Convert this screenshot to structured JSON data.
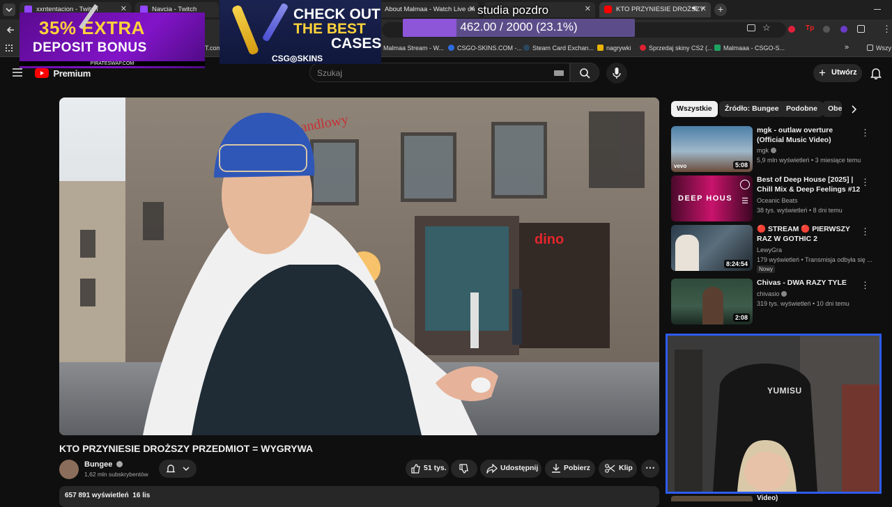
{
  "browser": {
    "tabs": [
      {
        "label": "xxntentacion - Twitch",
        "color": "#9146ff"
      },
      {
        "label": "Navcia - Twitch",
        "color": "#9146ff"
      },
      {
        "label": "About Malmaa - Watch Live on",
        "color": "#9146ff"
      },
      {
        "label": "studia pozdro - Watc",
        "color": "#9146ff"
      },
      {
        "label": "KTO PRZYNIESIE DROŻSZY",
        "color": "#ff0000"
      }
    ],
    "bookmarks": [
      {
        "label": "Malmaa Stream - W...",
        "color": "#9146ff"
      },
      {
        "label": "CSGO-SKINS.COM -...",
        "color": "#2d6cdf"
      },
      {
        "label": "Steam Card Exchan...",
        "color": "#2a475e"
      },
      {
        "label": "nagrywki",
        "color": "#e7b500"
      },
      {
        "label": "Sprzedaj skiny CS2 (...",
        "color": "#d23"
      },
      {
        "label": "Malmaaa - CSGO-S...",
        "color": "#1ea362"
      },
      {
        "label": "Wszy",
        "color": "#777"
      }
    ],
    "partial_bookmark": "T.com"
  },
  "overlay": {
    "bonus_line1": "35% EXTRA",
    "bonus_line2": "DEPOSIT BONUS",
    "bonus_site": "PIRATESWAP.COM",
    "skins_line1": "CHECK OUT",
    "skins_line2": "THE BEST",
    "skins_line3": "CASES",
    "skins_brand": "CSG◎SKINS",
    "progress_text": "462.00 / 2000 (23.1%)",
    "progress_fraction": 0.231,
    "stream_title": "studia pozdro"
  },
  "youtube": {
    "logo_label": "Premium",
    "search_placeholder": "Szukaj",
    "create_label": "Utwórz"
  },
  "video": {
    "title": "KTO PRZYNIESIE DROŻSZY PRZEDMIOT = WYGRYWA",
    "channel": "Bungee",
    "subscribers": "1,62 mln subskrybentów",
    "likes": "51 tys.",
    "share_label": "Udostępnij",
    "download_label": "Pobierz",
    "clip_label": "Klip",
    "views": "657 891 wyświetleń",
    "date": "16 lis"
  },
  "sidebar": {
    "chips": [
      "Wszystkie",
      "Źródło: Bungee",
      "Podobne",
      "Obe"
    ],
    "recommendations": [
      {
        "title": "mgk - outlaw overture (Official Music Video)",
        "channel": "mgk",
        "meta": "5,9 mln wyświetleń • 3 miesiące temu",
        "duration": "5:08"
      },
      {
        "title": "Best of Deep House [2025] | Chill Mix & Deep Feelings #12",
        "channel": "Oceanic Beats",
        "meta": "38 tys. wyświetleń • 8 dni temu",
        "duration": ""
      },
      {
        "title": "🔴 STREAM 🔴 PIERWSZY RAZ W GOTHIC 2",
        "channel": "LewyGra",
        "meta": "179 wyświetleń • Transmisja odbyła się ...",
        "duration": "8:24:54",
        "badge": "Nowy"
      },
      {
        "title": "Chivas - DWA RAZY TYLE",
        "channel": "chivasio",
        "meta": "319 tys. wyświetleń • 10 dni temu",
        "duration": "2:08"
      }
    ],
    "partial_bottom_title": "Video)"
  },
  "webcam": {
    "chair_brand": "YUMISU"
  }
}
